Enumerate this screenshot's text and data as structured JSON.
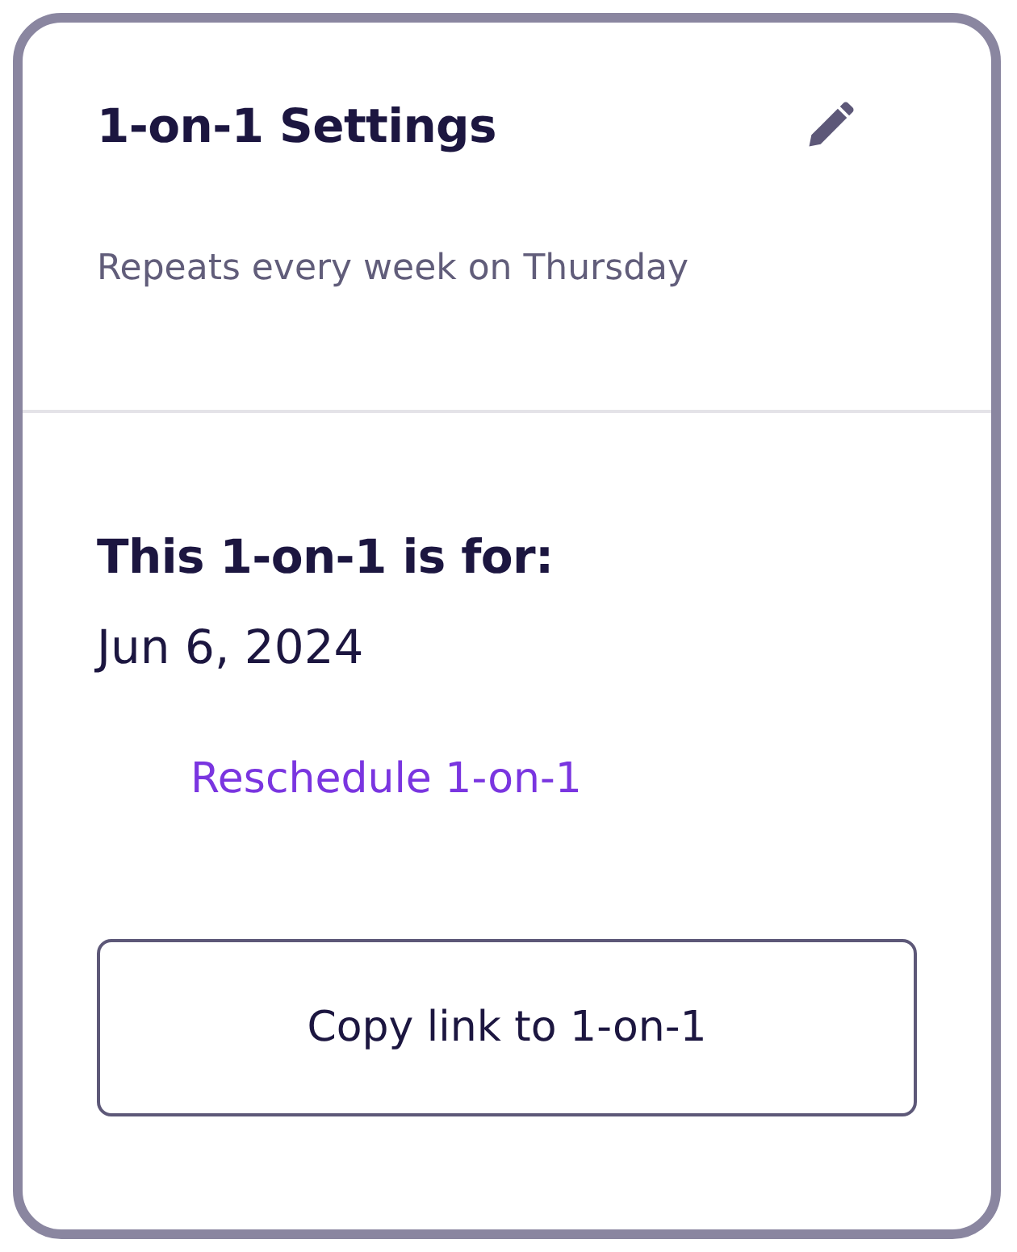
{
  "settings": {
    "title": "1-on-1 Settings",
    "recurrence": "Repeats every week on Thursday"
  },
  "occurrence": {
    "heading": "This 1-on-1 is for:",
    "date": "Jun 6, 2024",
    "reschedule_link": "Reschedule 1-on-1"
  },
  "buttons": [
    "Copy link to 1-on-1"
  ]
}
